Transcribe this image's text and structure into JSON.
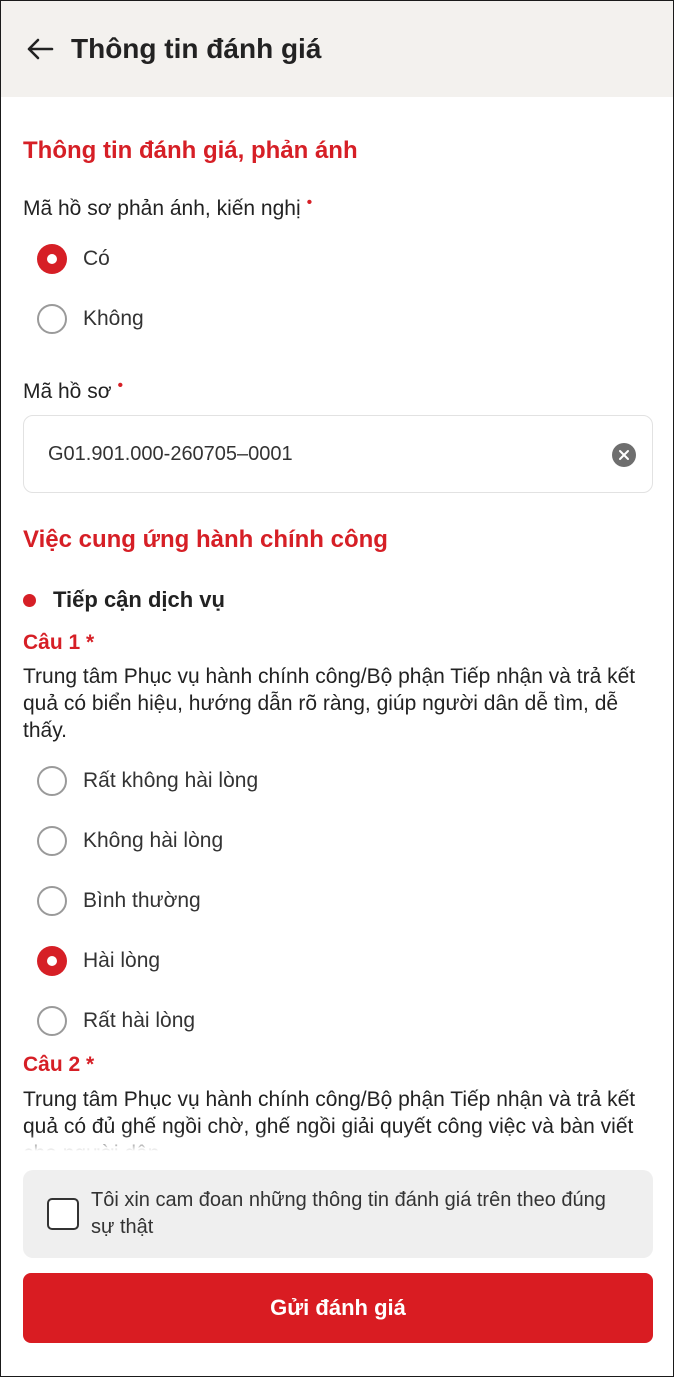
{
  "header": {
    "title": "Thông tin đánh giá",
    "back_icon": "arrow-left-icon"
  },
  "section1": {
    "title": "Thông tin đánh giá, phản ánh",
    "has_code_label": "Mã hồ sơ phản ánh, kiến nghị",
    "required_mark": "•",
    "options": [
      {
        "label": "Có",
        "checked": true
      },
      {
        "label": "Không",
        "checked": false
      }
    ],
    "code_label": "Mã hồ sơ",
    "code_value": "G01.901.000-260705–0001",
    "clear_icon": "clear-circle-icon"
  },
  "section2": {
    "title": "Việc cung ứng hành chính công",
    "group_title": "Tiếp cận dịch vụ",
    "q1": {
      "title": "Câu 1 *",
      "text": "Trung tâm Phục vụ hành chính công/Bộ phận Tiếp nhận và trả kết quả có biển hiệu, hướng dẫn rõ ràng, giúp người dân dễ tìm, dễ thấy.",
      "options": [
        {
          "label": "Rất không hài lòng",
          "checked": false
        },
        {
          "label": "Không hài lòng",
          "checked": false
        },
        {
          "label": "Bình thường",
          "checked": false
        },
        {
          "label": "Hài lòng",
          "checked": true
        },
        {
          "label": "Rất hài lòng",
          "checked": false
        }
      ]
    },
    "q2": {
      "title": "Câu 2 *",
      "text": "Trung tâm Phục vụ hành chính công/Bộ phận Tiếp nhận và trả kết quả có đủ ghế ngồi chờ, ghế ngồi giải quyết công việc và bàn viết cho người dân."
    }
  },
  "footer": {
    "commitment": "Tôi xin cam đoan những thông tin đánh giá trên theo đúng sự thật",
    "commitment_checked": false,
    "submit_label": "Gửi đánh giá"
  },
  "colors": {
    "accent": "#d61f26",
    "header_bg": "#f3f1ee",
    "commit_bg": "#efefef"
  }
}
